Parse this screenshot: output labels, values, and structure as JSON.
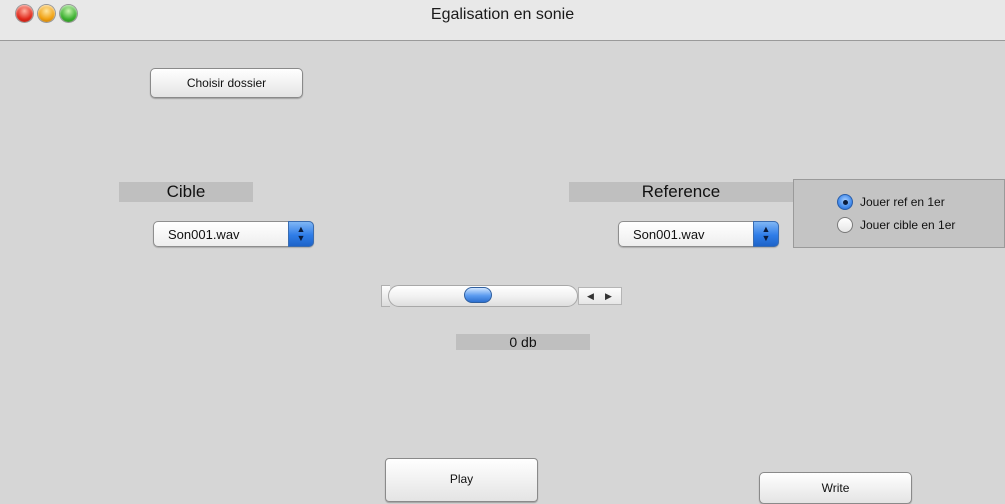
{
  "window": {
    "title": "Egalisation en sonie"
  },
  "buttons": {
    "choose_folder": "Choisir dossier",
    "play": "Play",
    "write": "Write"
  },
  "target": {
    "label": "Cible",
    "selected_file": "Son001.wav"
  },
  "reference": {
    "label": "Reference",
    "selected_file": "Son001.wav"
  },
  "play_order": {
    "options": [
      {
        "label": "Jouer ref en 1er",
        "selected": true
      },
      {
        "label": "Jouer cible en 1er",
        "selected": false
      }
    ]
  },
  "gain": {
    "value_text": "0 db",
    "slider_fraction": 0.5
  },
  "icons": {
    "stepper_left": "◀",
    "stepper_right": "▶",
    "popup_arrows": "▲▼"
  },
  "colors": {
    "accent": "#2f7de8",
    "background": "#d6d6d6",
    "label_bg": "#bfbfbf"
  }
}
